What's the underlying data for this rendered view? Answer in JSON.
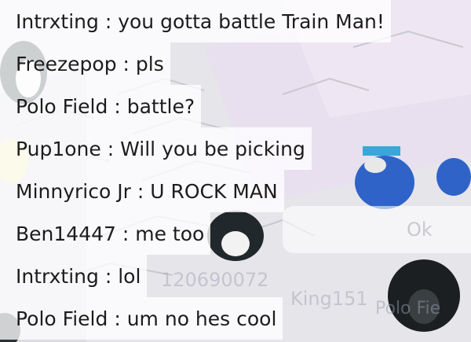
{
  "chat": {
    "separator": " : ",
    "messages": [
      {
        "user": "Intrxting",
        "text": "you gotta battle Train Man!"
      },
      {
        "user": "Freezepop",
        "text": "pls"
      },
      {
        "user": "Polo Field",
        "text": "battle?"
      },
      {
        "user": "Pup1one",
        "text": "Will you be picking"
      },
      {
        "user": "Minnyrico Jr",
        "text": "U ROCK MAN"
      },
      {
        "user": "Ben14447",
        "text": "me too"
      },
      {
        "user": "Intrxting",
        "text": "lol"
      },
      {
        "user": "Polo Field",
        "text": "um no hes cool"
      }
    ]
  },
  "background": {
    "speech_bubble_text": "Ok",
    "player_number_text": "120690072",
    "player_name_text": "King151",
    "player_name_text_2": "Polo Fie"
  },
  "colors": {
    "chat_background": "#ffffffc7",
    "chat_text": "#1c1c1c",
    "room_background": "#e9e8ec",
    "penguin_blue": "#2f63c8",
    "penguin_dark": "#1f2a2e"
  }
}
